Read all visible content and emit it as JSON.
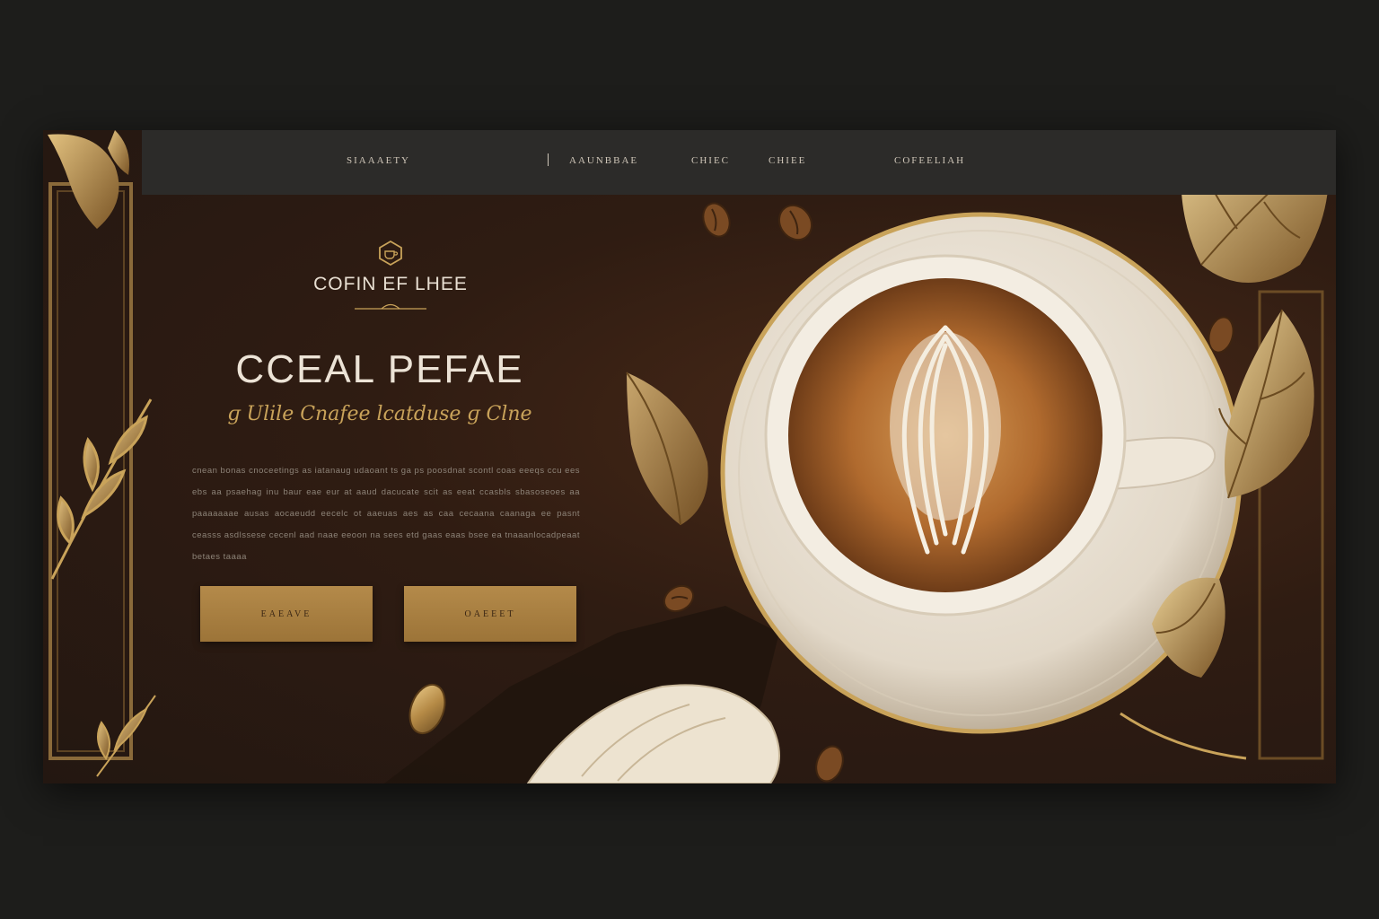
{
  "nav": {
    "items": [
      "SIAAAETY",
      "AAUNBBAE",
      "CHIEC",
      "CHIEE",
      "COFEELIAH"
    ]
  },
  "brand": {
    "logo_text": "COFIN EF LHEE"
  },
  "hero": {
    "headline": "CCEAL PEFAE",
    "script_line": "ɡ Ulile  Cnafee  lcatduse  ɡ  Clne",
    "body": "cnean bonas cnoceetings as iatanaug udaoant ts ga ps poosdnat scontl coas eeeqs ccu ees ebs aa psaehag inu baur eae eur at aaud dacucate scit as eeat ccasbls sbasoseoes aa paaaaaaae ausas aocaeudd eecelc ot aaeuas aes as caa cecaana caanaga ee pasnt ceasss asdlssese cecenl aad naae eeoon na sees etd gaas eaas bsee ea tnaaanlocadpeaat betaes taaaa"
  },
  "buttons": {
    "primary_label": "EAEAVE",
    "secondary_label": "OAEEET"
  },
  "colors": {
    "background": "#1d1d1b",
    "panel": "#2f1c12",
    "navbar": "#2c2b29",
    "gold": "#b48a4a",
    "cream": "#ece3d6"
  },
  "icons": {
    "logo": "coffee-hexagon-icon"
  }
}
